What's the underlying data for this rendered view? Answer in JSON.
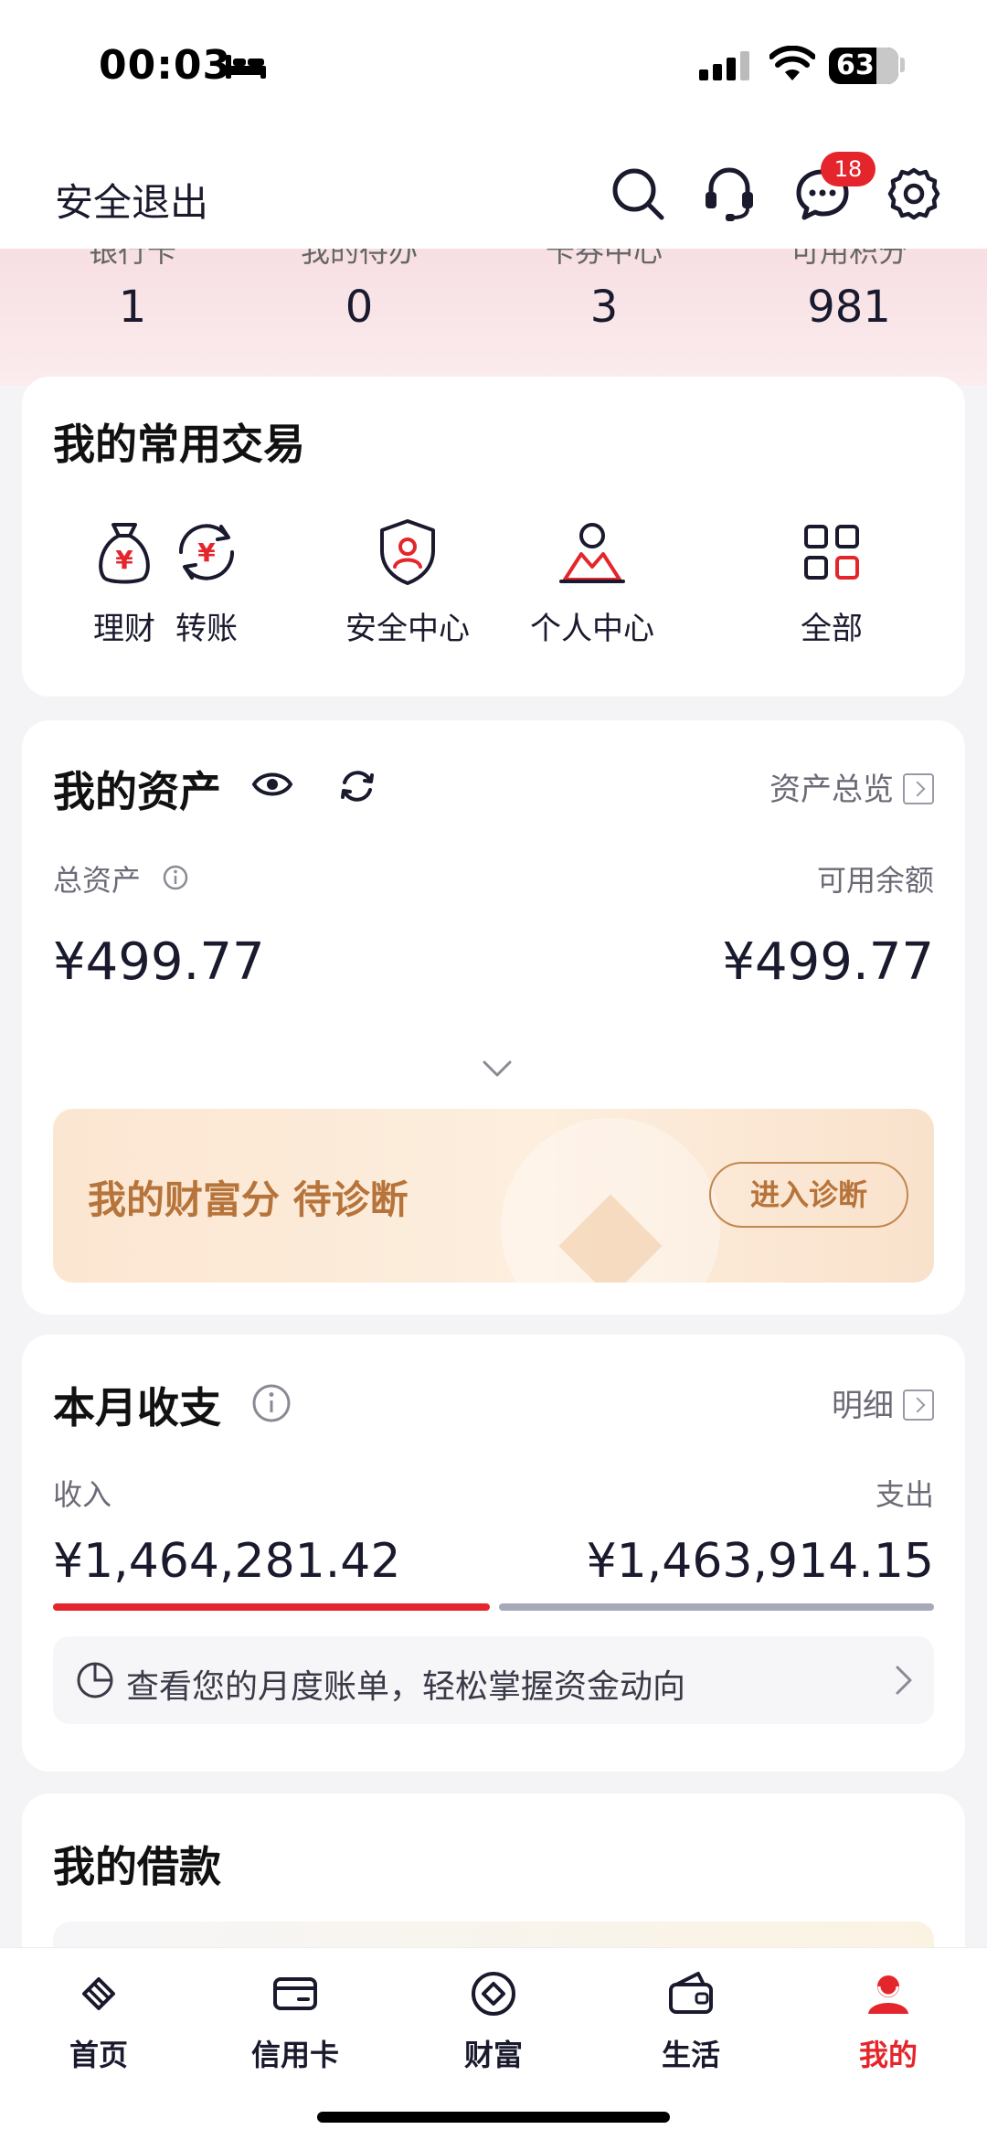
{
  "status_bar": {
    "time": "00:03",
    "battery": "63"
  },
  "header": {
    "logout_label": "安全退出",
    "message_badge": "18"
  },
  "summary": [
    {
      "label": "银行卡",
      "value": "1"
    },
    {
      "label": "我的待办",
      "value": "0"
    },
    {
      "label": "卡券中心",
      "value": "3"
    },
    {
      "label": "可用积分",
      "value": "981"
    }
  ],
  "frequent": {
    "title": "我的常用交易",
    "items": [
      {
        "label": "理财",
        "icon": "money-bag-icon"
      },
      {
        "label": "转账",
        "icon": "transfer-icon"
      },
      {
        "label": "安全中心",
        "icon": "shield-user-icon"
      },
      {
        "label": "个人中心",
        "icon": "person-icon"
      },
      {
        "label": "全部",
        "icon": "grid-icon"
      }
    ]
  },
  "assets": {
    "title": "我的资产",
    "overview_label": "资产总览",
    "total_label": "总资产",
    "available_label": "可用余额",
    "total_value": "¥499.77",
    "available_value": "¥499.77",
    "wealth_text": "我的财富分  待诊断",
    "wealth_button": "进入诊断"
  },
  "monthly": {
    "title": "本月收支",
    "detail_label": "明细",
    "income_label": "收入",
    "expense_label": "支出",
    "income_value": "¥1,464,281.42",
    "expense_value": "¥1,463,914.15",
    "bill_text": "查看您的月度账单，轻松掌握资金动向"
  },
  "loan": {
    "title": "我的借款"
  },
  "nav": [
    {
      "label": "首页",
      "icon": "home-icon"
    },
    {
      "label": "信用卡",
      "icon": "credit-card-icon"
    },
    {
      "label": "财富",
      "icon": "wealth-icon"
    },
    {
      "label": "生活",
      "icon": "wallet-icon"
    },
    {
      "label": "我的",
      "icon": "profile-icon",
      "active": true
    }
  ],
  "colors": {
    "accent": "#e4262c",
    "text": "#1a1a2e",
    "gold": "#b7743a"
  }
}
